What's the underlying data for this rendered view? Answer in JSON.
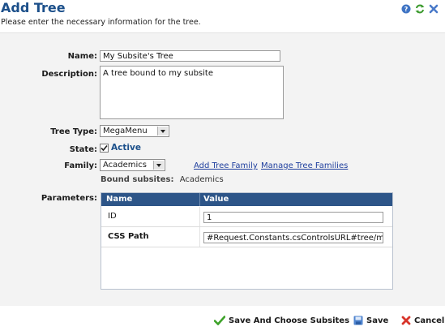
{
  "header": {
    "title": "Add Tree",
    "subtitle": "Please enter the necessary information for the tree.",
    "icons": [
      "help-icon",
      "refresh-icon",
      "close-icon"
    ]
  },
  "form": {
    "name_label": "Name:",
    "name_value": "My Subsite's Tree",
    "description_label": "Description:",
    "description_value": "A tree bound to my subsite",
    "tree_type_label": "Tree Type:",
    "tree_type_value": "MegaMenu",
    "state_label": "State:",
    "state_checked": true,
    "state_value": "Active",
    "family_label": "Family:",
    "family_value": "Academics",
    "add_family_link": "Add Tree Family",
    "manage_families_link": "Manage Tree Families",
    "bound_subsites_label": "Bound subsites:",
    "bound_subsites_value": "Academics",
    "parameters_label": "Parameters:"
  },
  "parameters": {
    "columns": [
      "Name",
      "Value"
    ],
    "rows": [
      {
        "name": "ID",
        "value": "1",
        "bold": false
      },
      {
        "name": "CSS Path",
        "value": "#Request.Constants.csControlsURL#tree/mega",
        "bold": true
      }
    ]
  },
  "footer": {
    "save_choose": "Save And Choose Subsites",
    "save": "Save",
    "cancel": "Cancel"
  },
  "colors": {
    "title": "#1b4f8a",
    "grid_header": "#2d5588",
    "link": "#1f3f9e",
    "panel_bg": "#f3f3f3"
  }
}
